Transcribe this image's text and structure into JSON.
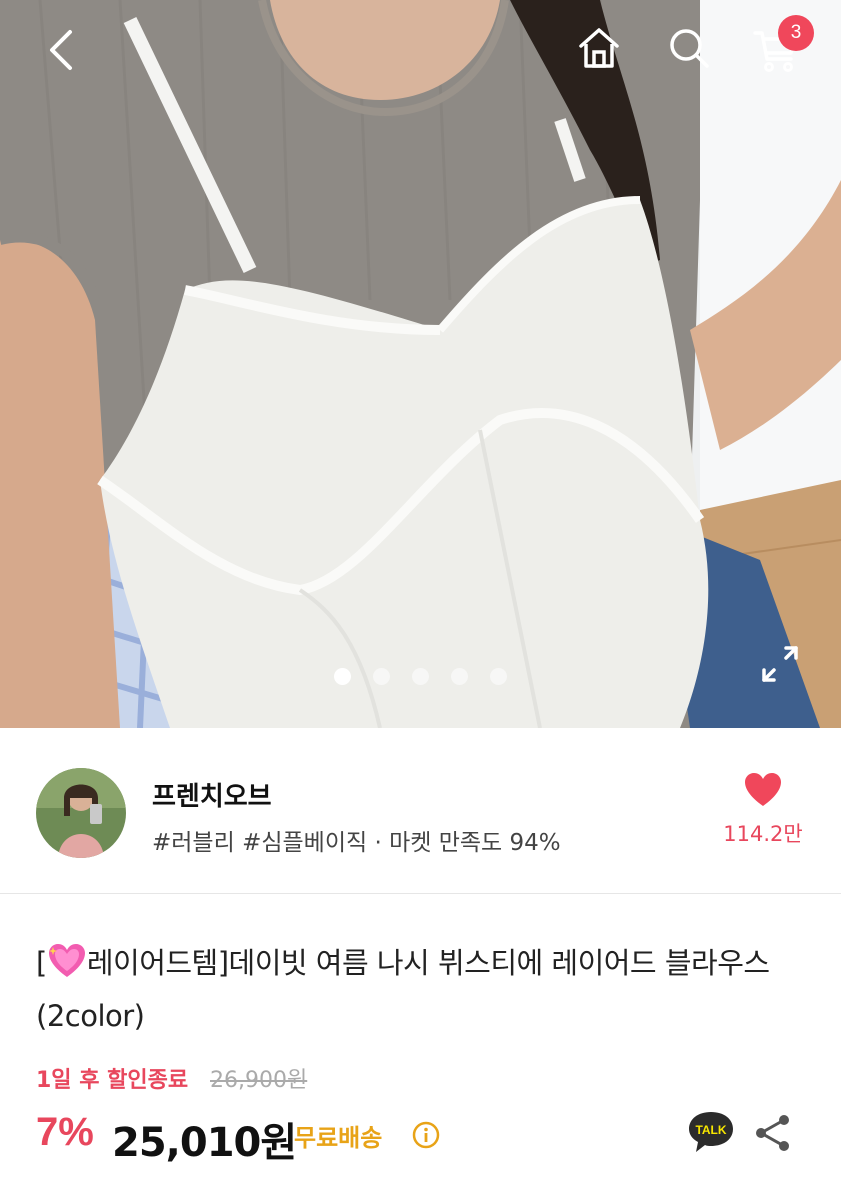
{
  "header": {
    "cart_count": "3"
  },
  "gallery": {
    "dots_total": 5,
    "active_index": 0
  },
  "shop": {
    "name": "프렌치오브",
    "tags": "#러블리 #심플베이직 · 마켓 만족도 94%",
    "likes": "114.2만"
  },
  "product": {
    "title_prefix": "[",
    "title_rest": "레이어드템]데이빗 여름 나시 뷔스티에 레이어드 블라우스(2color)",
    "deadline": "1일 후 할인종료",
    "original_price": "26,900원",
    "discount": "7%",
    "price": "25,010원",
    "shipping": "무료배송",
    "talk_label": "TALK"
  },
  "colors": {
    "accent": "#e8475d",
    "badge": "#f0475b",
    "shipping": "#e8a317",
    "talk_bg": "#2b2b2b",
    "talk_text": "#f7e600"
  }
}
